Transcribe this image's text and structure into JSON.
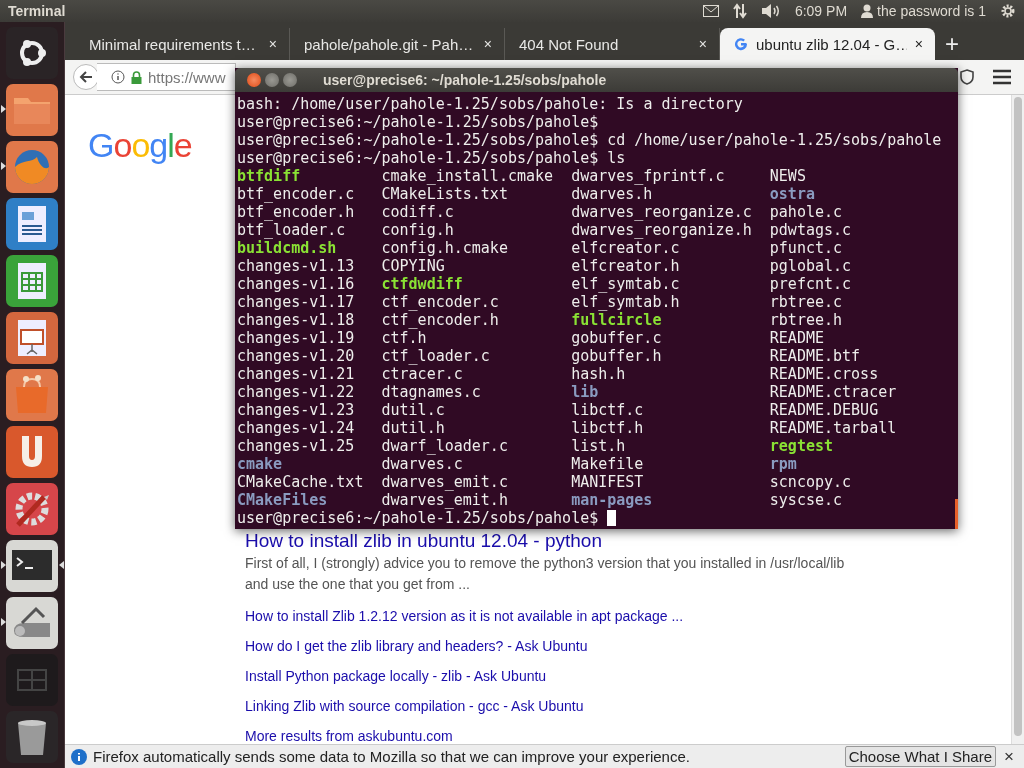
{
  "top_panel": {
    "app_title": "Terminal",
    "clock": "6:09 PM",
    "user": "the password is 1"
  },
  "launcher": {
    "items": [
      {
        "kind": "dash",
        "running": false,
        "focused": false
      },
      {
        "kind": "files",
        "running": true,
        "focused": false
      },
      {
        "kind": "browser",
        "running": true,
        "focused": false
      },
      {
        "kind": "writer",
        "running": false,
        "focused": false
      },
      {
        "kind": "calc",
        "running": false,
        "focused": false
      },
      {
        "kind": "impress",
        "running": false,
        "focused": false
      },
      {
        "kind": "store",
        "running": false,
        "focused": false
      },
      {
        "kind": "ubuntu_one",
        "running": false,
        "focused": false
      },
      {
        "kind": "settings",
        "running": false,
        "focused": false
      },
      {
        "kind": "terminal",
        "running": true,
        "focused": true
      },
      {
        "kind": "scanner",
        "running": true,
        "focused": false
      },
      {
        "kind": "workspaces",
        "running": false,
        "focused": false
      },
      {
        "kind": "trash",
        "running": false,
        "focused": false
      }
    ]
  },
  "browser": {
    "tabs": [
      {
        "title": "Minimal requirements t…",
        "selected": false,
        "favicon": false,
        "close": "×"
      },
      {
        "title": "pahole/pahole.git - Pah…",
        "selected": false,
        "favicon": false,
        "close": "×"
      },
      {
        "title": "404 Not Found",
        "selected": false,
        "favicon": false,
        "close": "×"
      },
      {
        "title": "ubuntu zlib 12.04 - G…",
        "selected": true,
        "favicon": true,
        "close": "×"
      }
    ],
    "new_tab": "+",
    "url": "https://www",
    "logo": "Google",
    "results": {
      "title": "How to install zlib in ubuntu 12.04 - python",
      "snippet": "First of all, I (strongly) advice you to remove the python3 version that you installed in /usr/local/lib and use the one that you get from ...",
      "links": [
        "How to install Zlib 1.2.12 version as it is not available in apt package ...",
        "How do I get the zlib library and headers? - Ask Ubuntu",
        "Install Python package locally - zlib - Ask Ubuntu",
        "Linking Zlib with source compilation - gcc - Ask Ubuntu",
        "More results from askubuntu.com"
      ]
    },
    "notification": {
      "text": "Firefox automatically sends some data to Mozilla so that we can improve your experience.",
      "button": "Choose What I Share",
      "close": "×"
    }
  },
  "terminal": {
    "title": "user@precise6: ~/pahole-1.25/sobs/pahole",
    "lines": [
      "bash: /home/user/pahole-1.25/sobs/pahole: Is a directory",
      "user@precise6:~/pahole-1.25/sobs/pahole$",
      "user@precise6:~/pahole-1.25/sobs/pahole$ cd /home/user/pahole-1.25/sobs/pahole",
      "user@precise6:~/pahole-1.25/sobs/pahole$ ls"
    ],
    "ls_output": [
      [
        {
          "name": "btfdiff",
          "kind": "exec"
        },
        {
          "name": "cmake_install.cmake",
          "kind": "file"
        },
        {
          "name": "dwarves_fprintf.c",
          "kind": "file"
        },
        {
          "name": "NEWS",
          "kind": "file"
        }
      ],
      [
        {
          "name": "btf_encoder.c",
          "kind": "file"
        },
        {
          "name": "CMakeLists.txt",
          "kind": "file"
        },
        {
          "name": "dwarves.h",
          "kind": "file"
        },
        {
          "name": "ostra",
          "kind": "dir"
        }
      ],
      [
        {
          "name": "btf_encoder.h",
          "kind": "file"
        },
        {
          "name": "codiff.c",
          "kind": "file"
        },
        {
          "name": "dwarves_reorganize.c",
          "kind": "file"
        },
        {
          "name": "pahole.c",
          "kind": "file"
        }
      ],
      [
        {
          "name": "btf_loader.c",
          "kind": "file"
        },
        {
          "name": "config.h",
          "kind": "file"
        },
        {
          "name": "dwarves_reorganize.h",
          "kind": "file"
        },
        {
          "name": "pdwtags.c",
          "kind": "file"
        }
      ],
      [
        {
          "name": "buildcmd.sh",
          "kind": "exec"
        },
        {
          "name": "config.h.cmake",
          "kind": "file"
        },
        {
          "name": "elfcreator.c",
          "kind": "file"
        },
        {
          "name": "pfunct.c",
          "kind": "file"
        }
      ],
      [
        {
          "name": "changes-v1.13",
          "kind": "file"
        },
        {
          "name": "COPYING",
          "kind": "file"
        },
        {
          "name": "elfcreator.h",
          "kind": "file"
        },
        {
          "name": "pglobal.c",
          "kind": "file"
        }
      ],
      [
        {
          "name": "changes-v1.16",
          "kind": "file"
        },
        {
          "name": "ctfdwdiff",
          "kind": "exec"
        },
        {
          "name": "elf_symtab.c",
          "kind": "file"
        },
        {
          "name": "prefcnt.c",
          "kind": "file"
        }
      ],
      [
        {
          "name": "changes-v1.17",
          "kind": "file"
        },
        {
          "name": "ctf_encoder.c",
          "kind": "file"
        },
        {
          "name": "elf_symtab.h",
          "kind": "file"
        },
        {
          "name": "rbtree.c",
          "kind": "file"
        }
      ],
      [
        {
          "name": "changes-v1.18",
          "kind": "file"
        },
        {
          "name": "ctf_encoder.h",
          "kind": "file"
        },
        {
          "name": "fullcircle",
          "kind": "exec"
        },
        {
          "name": "rbtree.h",
          "kind": "file"
        }
      ],
      [
        {
          "name": "changes-v1.19",
          "kind": "file"
        },
        {
          "name": "ctf.h",
          "kind": "file"
        },
        {
          "name": "gobuffer.c",
          "kind": "file"
        },
        {
          "name": "README",
          "kind": "file"
        }
      ],
      [
        {
          "name": "changes-v1.20",
          "kind": "file"
        },
        {
          "name": "ctf_loader.c",
          "kind": "file"
        },
        {
          "name": "gobuffer.h",
          "kind": "file"
        },
        {
          "name": "README.btf",
          "kind": "file"
        }
      ],
      [
        {
          "name": "changes-v1.21",
          "kind": "file"
        },
        {
          "name": "ctracer.c",
          "kind": "file"
        },
        {
          "name": "hash.h",
          "kind": "file"
        },
        {
          "name": "README.cross",
          "kind": "file"
        }
      ],
      [
        {
          "name": "changes-v1.22",
          "kind": "file"
        },
        {
          "name": "dtagnames.c",
          "kind": "file"
        },
        {
          "name": "lib",
          "kind": "dir"
        },
        {
          "name": "README.ctracer",
          "kind": "file"
        }
      ],
      [
        {
          "name": "changes-v1.23",
          "kind": "file"
        },
        {
          "name": "dutil.c",
          "kind": "file"
        },
        {
          "name": "libctf.c",
          "kind": "file"
        },
        {
          "name": "README.DEBUG",
          "kind": "file"
        }
      ],
      [
        {
          "name": "changes-v1.24",
          "kind": "file"
        },
        {
          "name": "dutil.h",
          "kind": "file"
        },
        {
          "name": "libctf.h",
          "kind": "file"
        },
        {
          "name": "README.tarball",
          "kind": "file"
        }
      ],
      [
        {
          "name": "changes-v1.25",
          "kind": "file"
        },
        {
          "name": "dwarf_loader.c",
          "kind": "file"
        },
        {
          "name": "list.h",
          "kind": "file"
        },
        {
          "name": "regtest",
          "kind": "exec"
        }
      ],
      [
        {
          "name": "cmake",
          "kind": "dir"
        },
        {
          "name": "dwarves.c",
          "kind": "file"
        },
        {
          "name": "Makefile",
          "kind": "file"
        },
        {
          "name": "rpm",
          "kind": "dir"
        }
      ],
      [
        {
          "name": "CMakeCache.txt",
          "kind": "file"
        },
        {
          "name": "dwarves_emit.c",
          "kind": "file"
        },
        {
          "name": "MANIFEST",
          "kind": "file"
        },
        {
          "name": "scncopy.c",
          "kind": "file"
        }
      ],
      [
        {
          "name": "CMakeFiles",
          "kind": "dir"
        },
        {
          "name": "dwarves_emit.h",
          "kind": "file"
        },
        {
          "name": "man-pages",
          "kind": "dir"
        },
        {
          "name": "syscse.c",
          "kind": "file"
        }
      ]
    ],
    "prompt": "user@precise6:~/pahole-1.25/sobs/pahole$"
  }
}
